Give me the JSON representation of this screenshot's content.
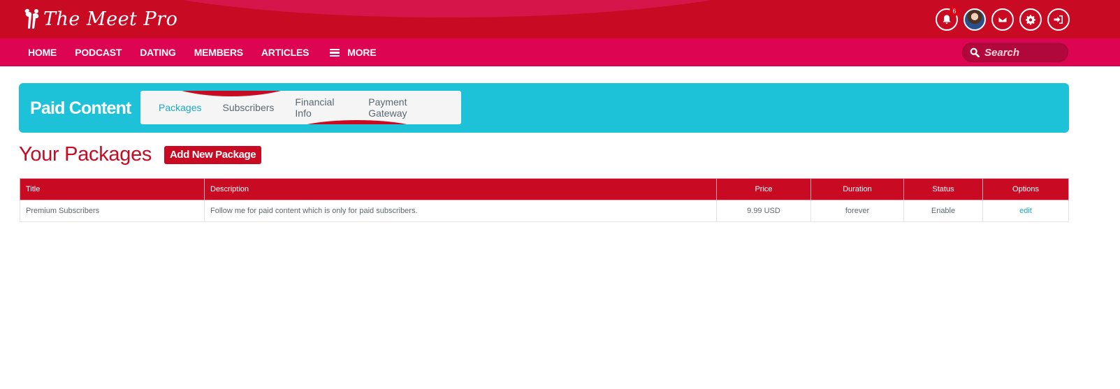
{
  "brand": {
    "name": "The Meet Pro"
  },
  "top_icons": {
    "notifications": {
      "icon": "bell-icon",
      "count": "6"
    },
    "avatar": "user-avatar",
    "messages": {
      "icon": "envelope-icon"
    },
    "settings": {
      "icon": "gear-icon"
    },
    "logout": {
      "icon": "sign-out-icon"
    }
  },
  "nav": {
    "items": [
      "HOME",
      "PODCAST",
      "DATING",
      "MEMBERS",
      "ARTICLES"
    ],
    "more_label": "MORE",
    "search_placeholder": "Search"
  },
  "paid_content": {
    "title": "Paid Content",
    "tabs": [
      "Packages",
      "Subscribers",
      "Financial Info",
      "Payment Gateway"
    ],
    "active_tab": "Packages"
  },
  "packages": {
    "heading": "Your Packages",
    "add_button": "Add New Package",
    "columns": [
      "Title",
      "Description",
      "Price",
      "Duration",
      "Status",
      "Options"
    ],
    "rows": [
      {
        "title": "Premium Subscribers",
        "description": "Follow me for paid content which is only for paid subscribers.",
        "price": "9.99 USD",
        "duration": "forever",
        "status": "Enable",
        "option": "edit"
      }
    ]
  },
  "colors": {
    "brand_red": "#c90a23",
    "nav_pink": "#dd0451",
    "accent_cyan": "#1dc2d9",
    "link": "#1aa9c4"
  }
}
